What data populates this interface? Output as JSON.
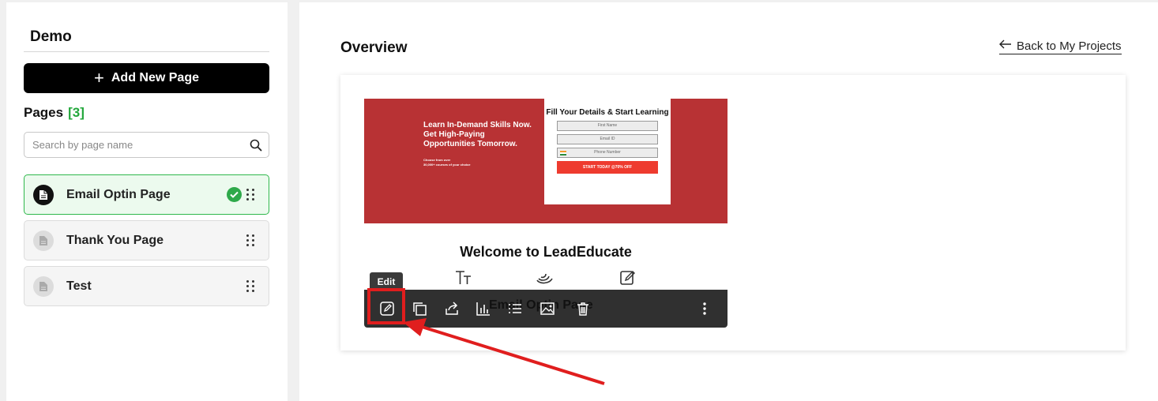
{
  "sidebar": {
    "project_title": "Demo",
    "add_button_label": "Add New Page",
    "pages_heading": "Pages",
    "pages_count": "[3]",
    "search_placeholder": "Search by page name",
    "pages": [
      {
        "label": "Email Optin Page",
        "active": true
      },
      {
        "label": "Thank You Page",
        "active": false
      },
      {
        "label": "Test",
        "active": false
      }
    ]
  },
  "main": {
    "title": "Overview",
    "back_link": "Back to My Projects",
    "preview": {
      "hero_headline": [
        "Learn In-Demand Skills Now.",
        "Get High-Paying",
        "Opportunities Tomorrow."
      ],
      "hero_sub": [
        "Choose from over",
        "30,000+ courses of your choice"
      ],
      "form_title": "Fill Your Details & Start Learning",
      "form_fields": [
        "First Name",
        "Email ID",
        "Phone Number"
      ],
      "form_button": "START TODAY @70% OFF",
      "welcome": "Welcome to LeadEducate"
    },
    "toolbar": {
      "tooltip": "Edit",
      "page_name_behind": "Email Optin Page",
      "buttons": [
        "edit-icon",
        "duplicate-icon",
        "share-icon",
        "analytics-icon",
        "list-icon",
        "image-icon",
        "trash-icon",
        "more-vertical-icon"
      ]
    }
  },
  "colors": {
    "accent_green": "#22a73b",
    "hero_red": "#b83234",
    "annotation_red": "#e01e1e",
    "toolbar_bg": "#303030"
  }
}
